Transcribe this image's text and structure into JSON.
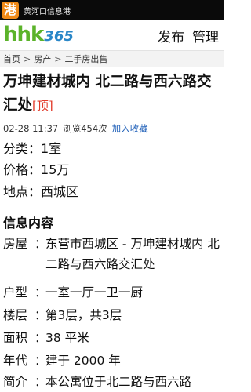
{
  "status_bar": {
    "app_badge": "港",
    "title": "黄河口信息港"
  },
  "header": {
    "logo_main": "hhk",
    "logo_num": "365",
    "publish_label": "发布",
    "manage_label": "管理"
  },
  "breadcrumb": {
    "items": [
      "首页",
      "房产",
      "二手房出售"
    ],
    "separator": ">"
  },
  "post": {
    "title": "万坤建材城内 北二路与西六路交汇处",
    "tag": "[顶]",
    "date": "02-28 11:37",
    "views": "浏览454次",
    "favorite_label": "加入收藏"
  },
  "summary": [
    {
      "label": "分类：",
      "value": "1室"
    },
    {
      "label": "价格：",
      "value": "15万"
    },
    {
      "label": "地点：",
      "value": "西城区"
    }
  ],
  "info": {
    "section_title": "信息内容",
    "rows": [
      {
        "label": "房屋",
        "colon": "：",
        "value": "东营市西城区 - 万坤建材城内 北二路与西六路交汇处"
      },
      {
        "label": "户型",
        "colon": "：",
        "value": "一室一厅一卫一厨"
      },
      {
        "label": "楼层",
        "colon": "：",
        "value": "第3层，共3层"
      },
      {
        "label": "面积",
        "colon": "：",
        "value": "38 平米"
      },
      {
        "label": "年代",
        "colon": "：",
        "value": "建于 2000 年"
      },
      {
        "label": "简介",
        "colon": "：",
        "value": "本公寓位于北二路与西六路"
      }
    ]
  }
}
